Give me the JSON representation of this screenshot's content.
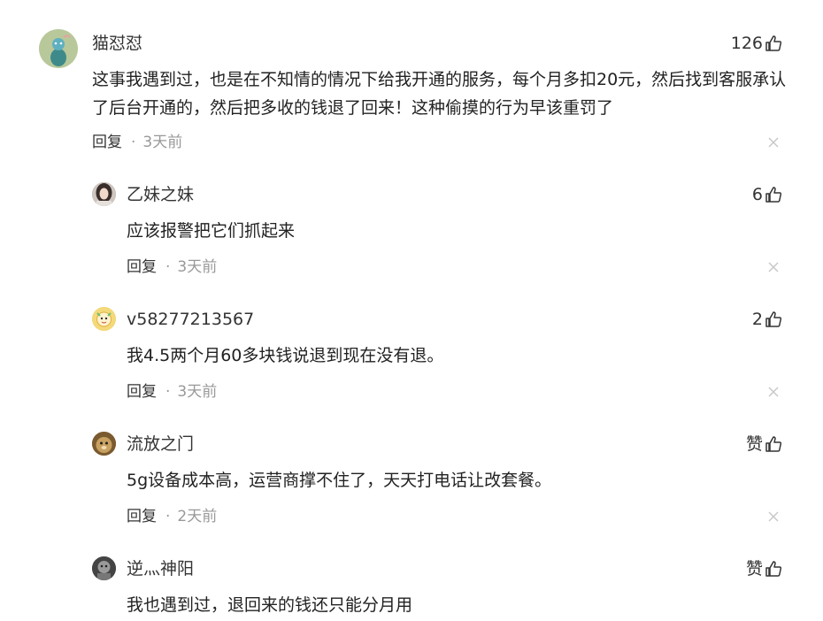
{
  "reply_label": "回复",
  "separator": "·",
  "comments": [
    {
      "username": "猫怼怼",
      "likes": "126",
      "text": "这事我遇到过，也是在不知情的情况下给我开通的服务，每个月多扣20元，然后找到客服承认了后台开通的，然后把多收的钱退了回来！这种偷摸的行为早该重罚了",
      "time": "3天前",
      "avatar_icon": "avatar-cartoon-figure",
      "avatar_color": "#b8c89a"
    },
    {
      "username": "乙妹之妹",
      "likes": "6",
      "text": "应该报警把它们抓起来",
      "time": "3天前",
      "avatar_icon": "avatar-girl-photo",
      "avatar_color": "#9a8f88"
    },
    {
      "username": "v58277213567",
      "likes": "2",
      "text": "我4.5两个月60多块钱说退到现在没有退。",
      "time": "3天前",
      "avatar_icon": "avatar-cartoon-face",
      "avatar_color": "#f4d97a"
    },
    {
      "username": "流放之门",
      "likes": "赞",
      "text": "5g设备成本高，运营商撑不住了，天天打电话让改套餐。",
      "time": "2天前",
      "avatar_icon": "avatar-animal-photo",
      "avatar_color": "#8a6a3a"
    },
    {
      "username": "逆灬神阳",
      "likes": "赞",
      "text": "我也遇到过，退回来的钱还只能分月用",
      "time": "",
      "avatar_icon": "avatar-dark-photo",
      "avatar_color": "#555555"
    }
  ]
}
